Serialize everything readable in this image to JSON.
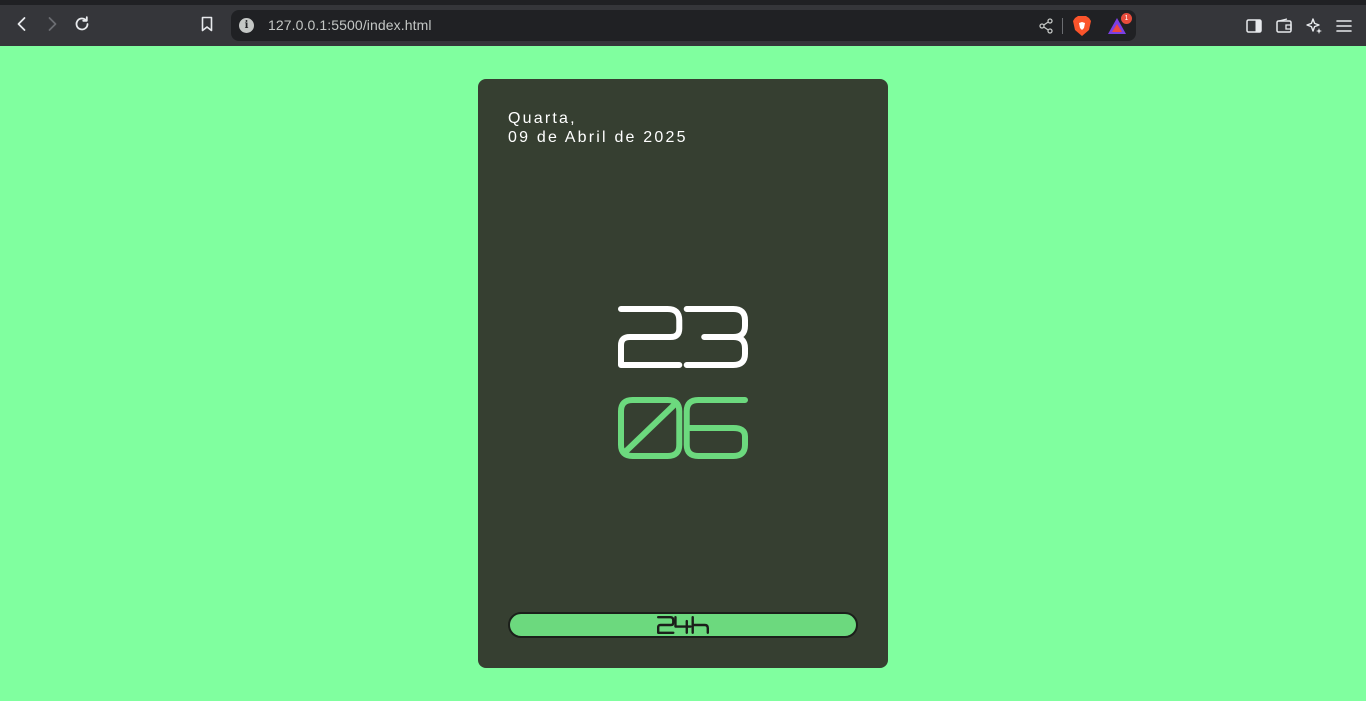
{
  "browser": {
    "url": "127.0.0.1:5500/index.html",
    "rewards_badge": "1",
    "icons": {
      "back": "back-icon",
      "forward": "forward-icon",
      "reload": "reload-icon",
      "bookmark": "bookmark-icon",
      "info": "info-icon",
      "share": "share-icon",
      "brave": "brave-shield-icon",
      "rewards": "brave-rewards-icon",
      "sidebar": "sidebar-icon",
      "wallet": "wallet-icon",
      "leo": "leo-ai-icon",
      "menu": "menu-icon"
    }
  },
  "clock": {
    "day": "Quarta,",
    "date": "09 de Abril de 2025",
    "hours": "23",
    "minutes": "06",
    "mode_label": "24h"
  },
  "colors": {
    "page_background": "#80ff9f",
    "card_background": "#363f31",
    "hours_color": "#ffffff",
    "minutes_color": "#6cd97e",
    "toggle_fill": "#6cd97e",
    "toggle_text": "#1b1f1a"
  }
}
